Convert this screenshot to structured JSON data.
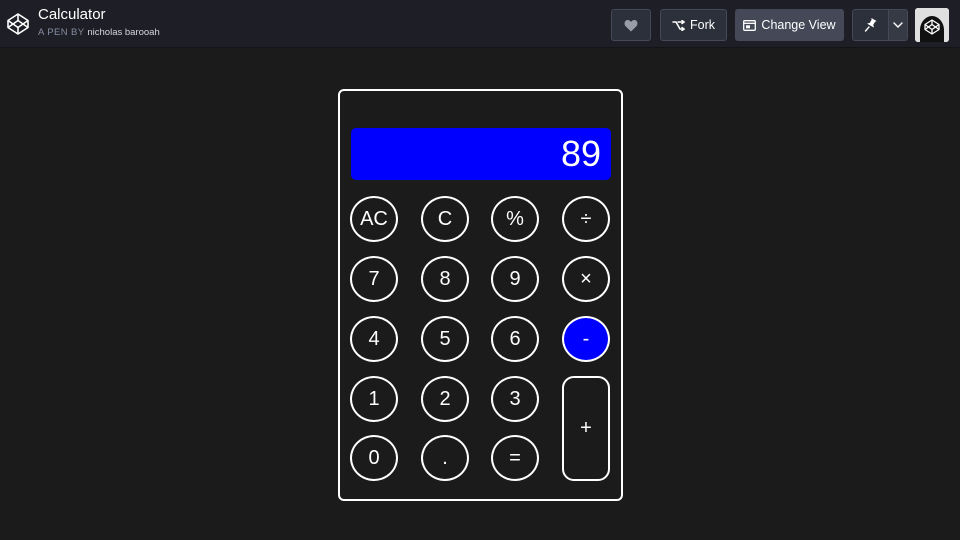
{
  "header": {
    "title": "Calculator",
    "byline_prefix": "A PEN BY",
    "author": "nicholas barooah",
    "fork_label": "Fork",
    "change_view_label": "Change View"
  },
  "calculator": {
    "display_value": "89",
    "accent_color": "#0000ff",
    "keys": {
      "ac": "AC",
      "c": "C",
      "percent": "%",
      "divide": "÷",
      "seven": "7",
      "eight": "8",
      "nine": "9",
      "multiply": "×",
      "four": "4",
      "five": "5",
      "six": "6",
      "minus": "-",
      "one": "1",
      "two": "2",
      "three": "3",
      "plus": "+",
      "zero": "0",
      "decimal": ".",
      "equals": "="
    },
    "active_operator": "minus"
  }
}
